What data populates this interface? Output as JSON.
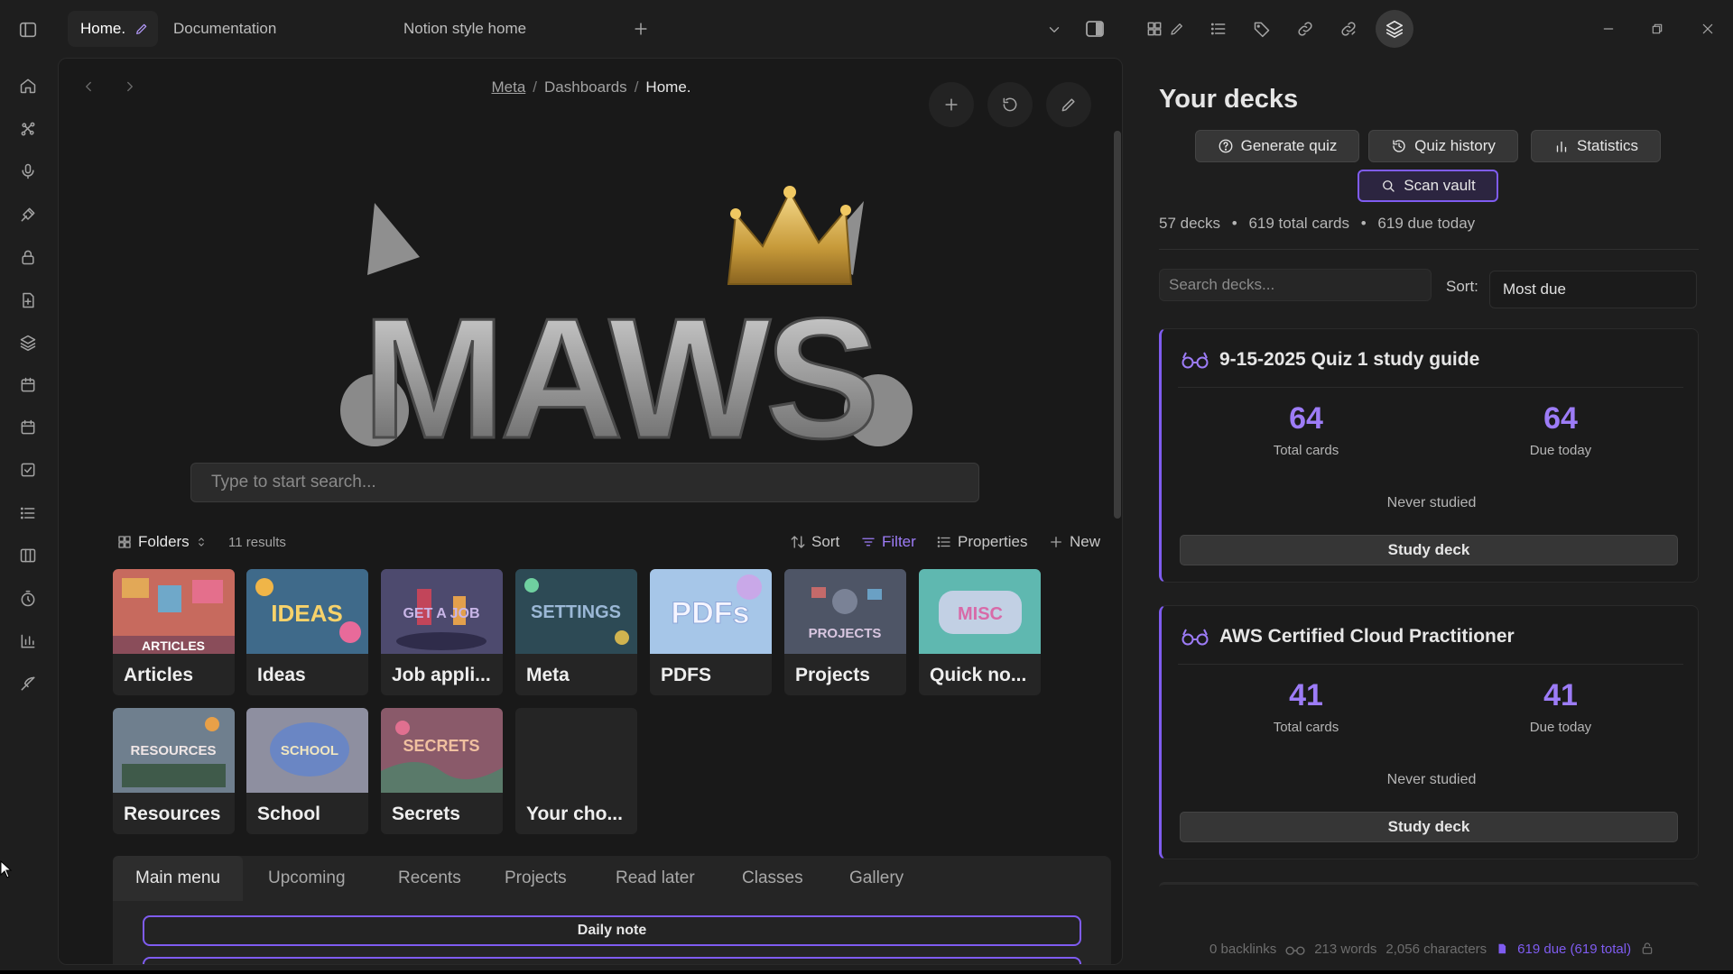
{
  "tabs": [
    {
      "label": "Home.",
      "active": true
    },
    {
      "label": "Documentation"
    },
    {
      "label": "Notion style home"
    }
  ],
  "breadcrumb": {
    "first": "Meta",
    "second": "Dashboards",
    "current": "Home.",
    "separator": "/"
  },
  "search": {
    "placeholder": "Type to start search..."
  },
  "base_toolbar": {
    "view_label": "Folders",
    "results": "11 results",
    "sort": "Sort",
    "filter": "Filter",
    "properties": "Properties",
    "new": "New"
  },
  "folders": [
    {
      "title": "Articles",
      "thumb_text": "ARTICLES"
    },
    {
      "title": "Ideas",
      "thumb_text": "IDEAS"
    },
    {
      "title": "Job appli...",
      "thumb_text": "GET A JOB"
    },
    {
      "title": "Meta",
      "thumb_text": "SETTINGS"
    },
    {
      "title": "PDFS",
      "thumb_text": "PDFs"
    },
    {
      "title": "Projects",
      "thumb_text": "PROJECTS"
    },
    {
      "title": "Quick no...",
      "thumb_text": "MISC"
    },
    {
      "title": "Resources",
      "thumb_text": "RESOURCES"
    },
    {
      "title": "School",
      "thumb_text": "SCHOOL"
    },
    {
      "title": "Secrets",
      "thumb_text": "SECRETS"
    },
    {
      "title": "Your cho...",
      "thumb_text": ""
    }
  ],
  "panel_tabs": [
    "Main menu",
    "Upcoming",
    "Recents",
    "Projects",
    "Read later",
    "Classes",
    "Gallery"
  ],
  "daily_note": "Daily note",
  "logo": {
    "text": "MAWS"
  },
  "decks": {
    "title": "Your decks",
    "buttons": {
      "generate": "Generate quiz",
      "history": "Quiz history",
      "statistics": "Statistics",
      "scan": "Scan vault"
    },
    "stats": {
      "decks": "57 decks",
      "cards": "619 total cards",
      "due": "619 due today"
    },
    "search_placeholder": "Search decks...",
    "sort_label": "Sort:",
    "sort_value": "Most due",
    "list": [
      {
        "name": "9-15-2025 Quiz 1 study guide",
        "total": "64",
        "total_label": "Total cards",
        "due": "64",
        "due_label": "Due today",
        "status": "Never studied",
        "button": "Study deck"
      },
      {
        "name": "AWS Certified Cloud Practitioner",
        "total": "41",
        "total_label": "Total cards",
        "due": "41",
        "due_label": "Due today",
        "status": "Never studied",
        "button": "Study deck"
      }
    ]
  },
  "status_bar": {
    "backlinks": "0 backlinks",
    "words": "213 words",
    "characters": "2,056 characters",
    "due": "619 due (619 total)"
  },
  "colors": {
    "accent": "#7f5cf0",
    "accent_text": "#9d7cf7",
    "background": "#1e1e1e"
  }
}
